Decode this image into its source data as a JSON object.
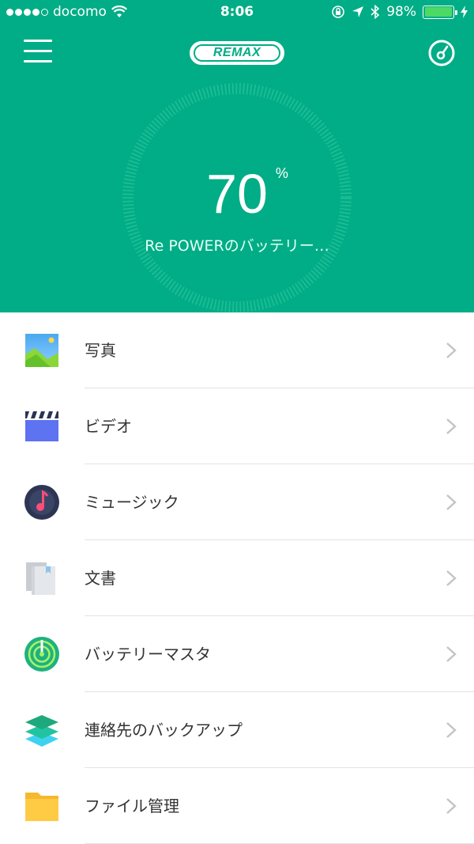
{
  "status_bar": {
    "carrier": "docomo",
    "time": "8:06",
    "battery_percent": "98%"
  },
  "header": {
    "logo_text": "REMAX",
    "battery_level": "70",
    "percent_sign": "%",
    "subtitle": "Re POWERのバッテリー…",
    "accent_color": "#00ad86"
  },
  "menu_items": [
    {
      "label": "写真",
      "icon": "photo-icon"
    },
    {
      "label": "ビデオ",
      "icon": "video-icon"
    },
    {
      "label": "ミュージック",
      "icon": "music-icon"
    },
    {
      "label": "文書",
      "icon": "document-icon"
    },
    {
      "label": "バッテリーマスタ",
      "icon": "battery-master-icon"
    },
    {
      "label": "連絡先のバックアップ",
      "icon": "contacts-backup-icon"
    },
    {
      "label": "ファイル管理",
      "icon": "folder-icon"
    }
  ]
}
